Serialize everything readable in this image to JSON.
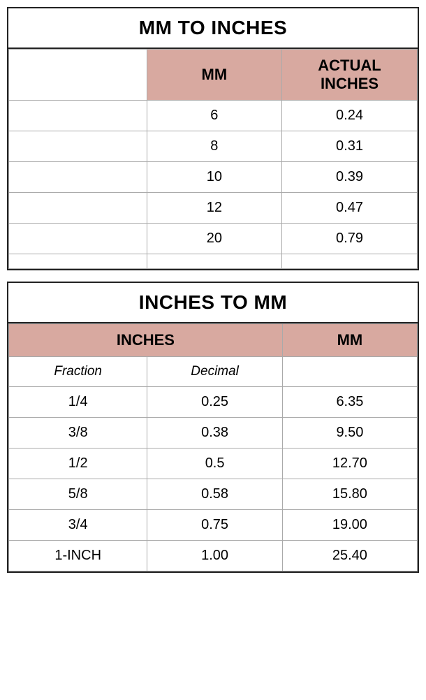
{
  "mm_to_inches": {
    "title": "MM TO INCHES",
    "col_headers": {
      "mm": "MM",
      "actual_inches": "ACTUAL INCHES"
    },
    "rows": [
      {
        "mm": "6",
        "inches": "0.24"
      },
      {
        "mm": "8",
        "inches": "0.31"
      },
      {
        "mm": "10",
        "inches": "0.39"
      },
      {
        "mm": "12",
        "inches": "0.47"
      },
      {
        "mm": "20",
        "inches": "0.79"
      }
    ]
  },
  "inches_to_mm": {
    "title": "INCHES TO MM",
    "col_header_inches": "INCHES",
    "col_header_mm": "MM",
    "sub_header_fraction": "Fraction",
    "sub_header_decimal": "Decimal",
    "rows": [
      {
        "fraction": "1/4",
        "decimal": "0.25",
        "mm": "6.35"
      },
      {
        "fraction": "3/8",
        "decimal": "0.38",
        "mm": "9.50"
      },
      {
        "fraction": "1/2",
        "decimal": "0.5",
        "mm": "12.70"
      },
      {
        "fraction": "5/8",
        "decimal": "0.58",
        "mm": "15.80"
      },
      {
        "fraction": "3/4",
        "decimal": "0.75",
        "mm": "19.00"
      },
      {
        "fraction": "1-INCH",
        "decimal": "1.00",
        "mm": "25.40"
      }
    ]
  }
}
